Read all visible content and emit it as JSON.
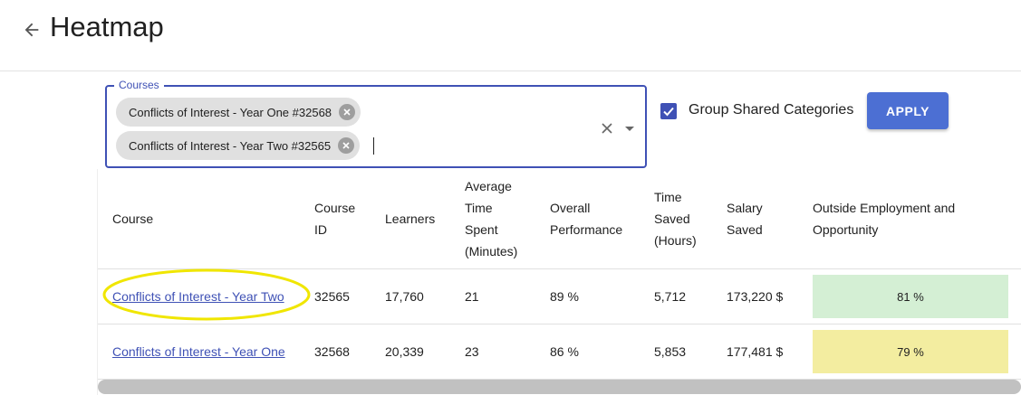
{
  "header": {
    "title": "Heatmap",
    "back_icon": "arrow-left-icon"
  },
  "filters": {
    "courses_label": "Courses",
    "selected_courses": [
      "Conflicts of Interest - Year One #32568",
      "Conflicts of Interest - Year Two #32565"
    ],
    "group_shared_categories": {
      "label": "Group Shared Categories",
      "checked": true
    },
    "apply_label": "APPLY"
  },
  "table": {
    "headers": {
      "course": "Course",
      "course_id_1": "Course",
      "course_id_2": "ID",
      "learners": "Learners",
      "avg_time_1": "Average",
      "avg_time_2": "Time",
      "avg_time_3": "Spent",
      "avg_time_4": "(Minutes)",
      "overall_1": "Overall",
      "overall_2": "Performance",
      "time_saved_1": "Time",
      "time_saved_2": "Saved",
      "time_saved_3": "(Hours)",
      "salary_1": "Salary",
      "salary_2": "Saved",
      "outside_1": "Outside Employment and",
      "outside_2": "Opportunity"
    },
    "rows": [
      {
        "course": "Conflicts of Interest - Year Two",
        "course_id": "32565",
        "learners": "17,760",
        "avg_time": "21",
        "overall": "89 %",
        "time_saved": "5,712",
        "salary_saved": "173,220 $",
        "outside_employment": "81 %",
        "heat_color": "#d4efd4"
      },
      {
        "course": "Conflicts of Interest - Year One",
        "course_id": "32568",
        "learners": "20,339",
        "avg_time": "23",
        "overall": "86 %",
        "time_saved": "5,853",
        "salary_saved": "177,481 $",
        "outside_employment": "79 %",
        "heat_color": "#f3eda0"
      }
    ]
  },
  "colors": {
    "accent": "#3f51b5",
    "apply_button": "#4c6fd3",
    "highlight": "#f0e600"
  }
}
